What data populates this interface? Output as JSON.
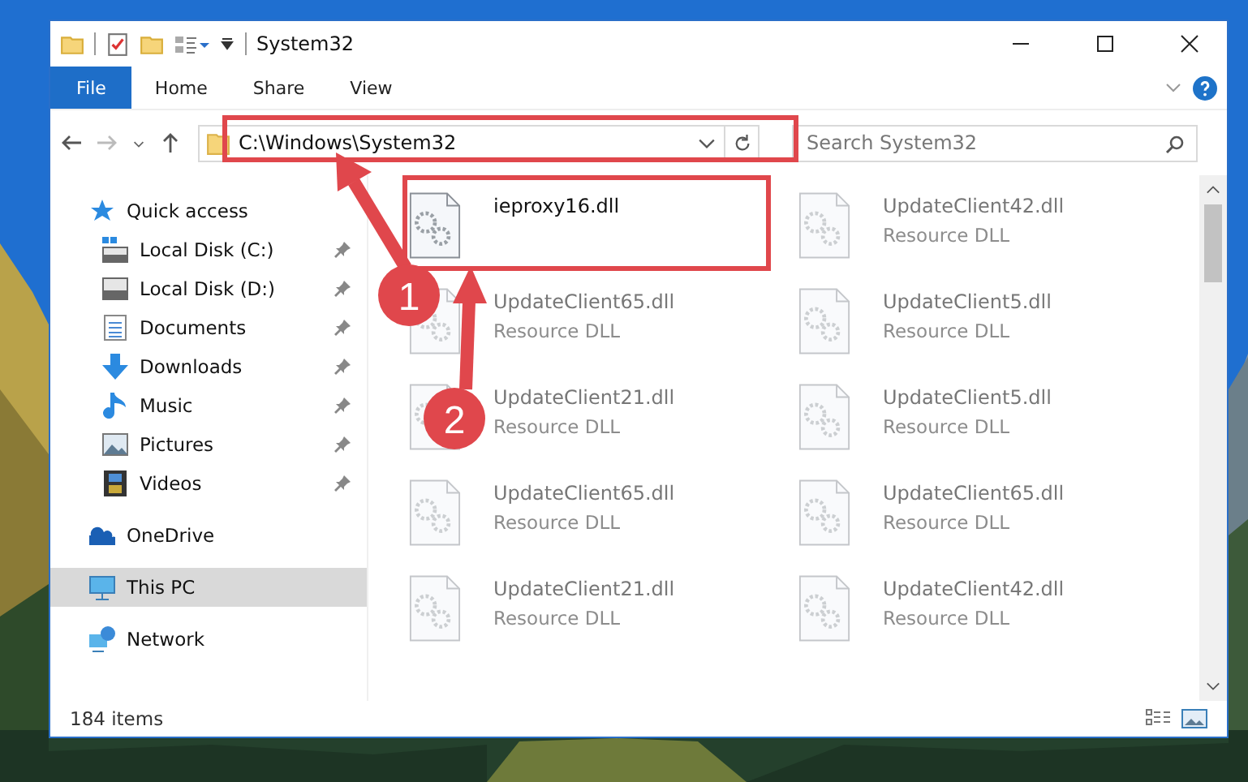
{
  "window": {
    "title": "System32"
  },
  "ribbon_tabs": [
    {
      "label": "File",
      "selected": true
    },
    {
      "label": "Home",
      "selected": false
    },
    {
      "label": "Share",
      "selected": false
    },
    {
      "label": "View",
      "selected": false
    }
  ],
  "address_bar": {
    "path": "C:\\Windows\\System32"
  },
  "search": {
    "placeholder": "Search System32"
  },
  "nav_items": [
    {
      "label": "Quick access",
      "kind": "quick",
      "selected": false,
      "children": [
        {
          "label": "Local Disk (C:)",
          "kind": "diskc",
          "pinned": true
        },
        {
          "label": "Local Disk (D:)",
          "kind": "disk",
          "pinned": true
        },
        {
          "label": "Documents",
          "kind": "docs",
          "pinned": true
        },
        {
          "label": "Downloads",
          "kind": "down",
          "pinned": true
        },
        {
          "label": "Music",
          "kind": "music",
          "pinned": true
        },
        {
          "label": "Pictures",
          "kind": "pics",
          "pinned": true
        },
        {
          "label": "Videos",
          "kind": "videos",
          "pinned": true
        }
      ]
    },
    {
      "label": "OneDrive",
      "kind": "cloud",
      "selected": false
    },
    {
      "label": "This PC",
      "kind": "pc",
      "selected": true
    },
    {
      "label": "Network",
      "kind": "network",
      "selected": false
    }
  ],
  "files": [
    {
      "name": "ieproxy16.dll",
      "blurred": false
    },
    {
      "name": "UpdateClient42.dll",
      "type": "Resource DLL",
      "blurred": true
    },
    {
      "name": "UpdateClient65.dll",
      "type": "Resource DLL",
      "blurred": true
    },
    {
      "name": "UpdateClient5.dll",
      "type": "Resource DLL",
      "blurred": true
    },
    {
      "name": "UpdateClient21.dll",
      "type": "Resource DLL",
      "blurred": true
    },
    {
      "name": "UpdateClient5.dll",
      "type": "Resource DLL",
      "blurred": true
    },
    {
      "name": "UpdateClient65.dll",
      "type": "Resource DLL",
      "blurred": true
    },
    {
      "name": "UpdateClient65.dll",
      "type": "Resource DLL",
      "blurred": true
    },
    {
      "name": "UpdateClient21.dll",
      "type": "Resource DLL",
      "blurred": true
    },
    {
      "name": "UpdateClient42.dll",
      "type": "Resource DLL",
      "blurred": true
    }
  ],
  "status_bar": {
    "count": "184 items"
  },
  "annotations": [
    {
      "number": "1"
    },
    {
      "number": "2"
    }
  ]
}
